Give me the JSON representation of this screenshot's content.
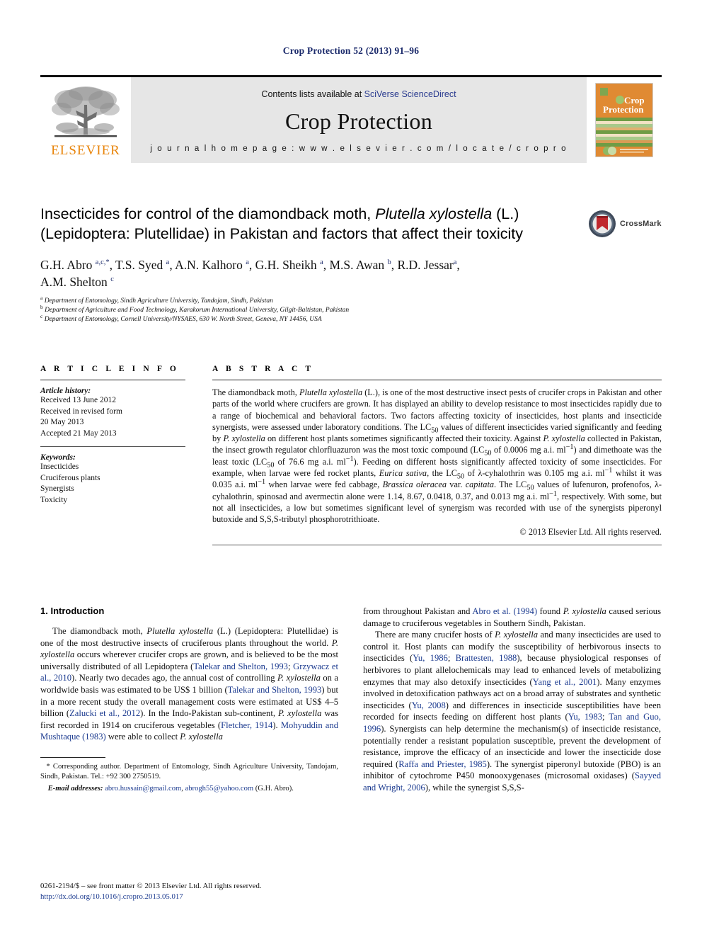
{
  "running_head": "Crop Protection 52 (2013) 91–96",
  "masthead": {
    "contents_prefix": "Contents lists available at ",
    "contents_link": "SciVerse ScienceDirect",
    "journal_name": "Crop Protection",
    "homepage": "j o u r n a l   h o m e p a g e :   w w w . e l s e v i e r . c o m / l o c a t e / c r o p r o",
    "publisher_wordmark": "ELSEVIER",
    "cover_title_line1": "Crop",
    "cover_title_line2": "Protection"
  },
  "article": {
    "title_part1": "Insecticides for control of the diamondback moth, ",
    "title_italic1": "Plutella xylostella",
    "title_part2": " (L.) (Lepidoptera: Plutellidae) in Pakistan and factors that affect their toxicity",
    "crossmark_label": "CrossMark",
    "authors": "G.H. Abro a,c,*, T.S. Syed a, A.N. Kalhoro a, G.H. Sheikh a, M.S. Awan b, R.D. Jessar a, A.M. Shelton c",
    "affiliations": [
      "Department of Entomology, Sindh Agriculture University, Tandojam, Sindh, Pakistan",
      "Department of Agriculture and Food Technology, Karakorum International University, Gilgit-Baltistan, Pakistan",
      "Department of Entomology, Cornell University/NYSAES, 630 W. North Street, Geneva, NY 14456, USA"
    ]
  },
  "article_info": {
    "heading": "A R T I C L E   I N F O",
    "history_label": "Article history:",
    "history_lines": [
      "Received 13 June 2012",
      "Received in revised form",
      "20 May 2013",
      "Accepted 21 May 2013"
    ],
    "keywords_label": "Keywords:",
    "keywords": [
      "Insecticides",
      "Cruciferous plants",
      "Synergists",
      "Toxicity"
    ]
  },
  "abstract": {
    "heading": "A B S T R A C T",
    "copyright": "© 2013 Elsevier Ltd. All rights reserved."
  },
  "introduction": {
    "heading": "1. Introduction"
  },
  "footnote": {
    "corresponding": "* Corresponding author. Department of Entomology, Sindh Agriculture University, Tandojam, Sindh, Pakistan. Tel.: +92 300 2750519.",
    "email_label": "E-mail addresses:",
    "email1": "abro.hussain@gmail.com",
    "email2": "abrogh55@yahoo.com",
    "email_suffix": " (G.H. Abro)."
  },
  "imprint": {
    "line1": "0261-2194/$ – see front matter © 2013 Elsevier Ltd. All rights reserved.",
    "doi": "http://dx.doi.org/10.1016/j.cropro.2013.05.017"
  },
  "colors": {
    "link": "#1b3a8f",
    "running_head": "#1b2a6b",
    "elsevier_orange": "#E8850C",
    "masthead_bg": "#e6e6e6",
    "cover_orange": "#E08A33",
    "crossmark_red": "#c0272d"
  }
}
